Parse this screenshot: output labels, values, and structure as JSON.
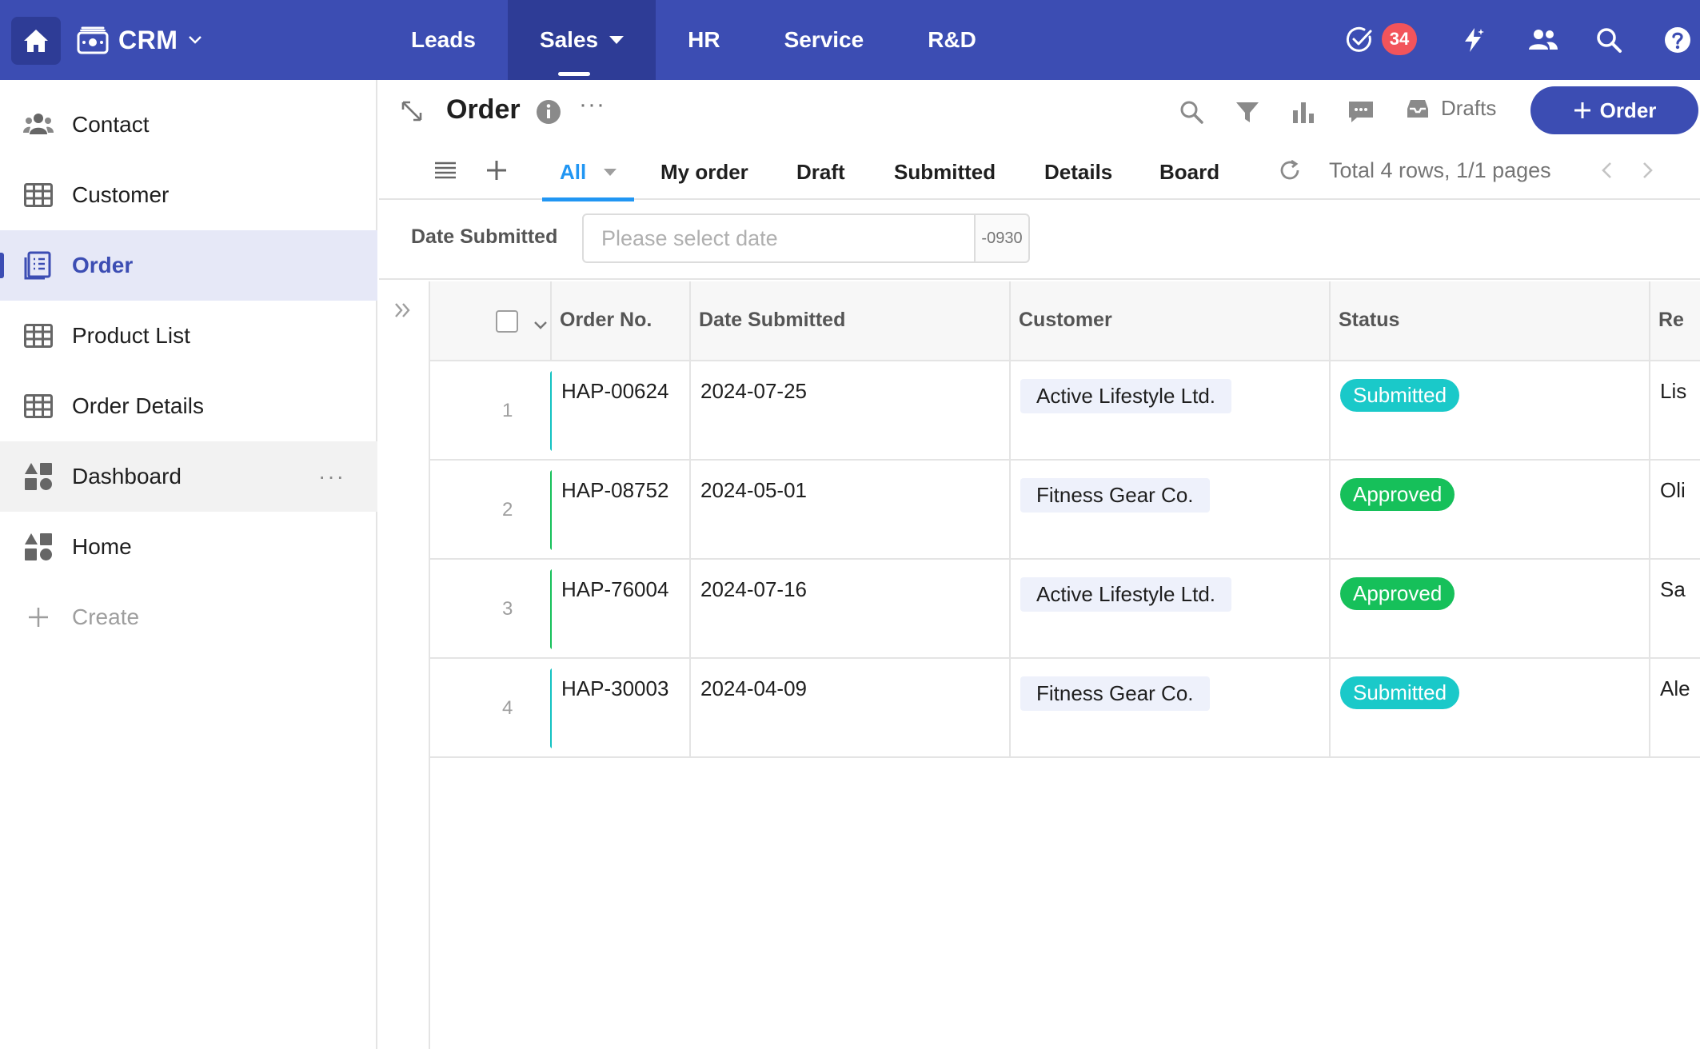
{
  "topbar": {
    "app_name": "CRM",
    "nav": [
      {
        "label": "Leads",
        "active": false
      },
      {
        "label": "Sales",
        "active": true
      },
      {
        "label": "HR",
        "active": false
      },
      {
        "label": "Service",
        "active": false
      },
      {
        "label": "R&D",
        "active": false
      }
    ],
    "notification_count": "34",
    "colors": {
      "bar": "#3c4db3",
      "bar_active": "#2e3c96",
      "badge": "#f2545b"
    },
    "icons": [
      "home-icon",
      "app-wallet-icon",
      "task-check-icon",
      "lightning-icon",
      "people-icon",
      "search-icon",
      "help-icon"
    ]
  },
  "sidebar": {
    "items": [
      {
        "label": "Contact",
        "icon": "contacts-icon",
        "active": false
      },
      {
        "label": "Customer",
        "icon": "table-icon",
        "active": false
      },
      {
        "label": "Order",
        "icon": "form-list-icon",
        "active": true
      },
      {
        "label": "Product List",
        "icon": "table-icon",
        "active": false
      },
      {
        "label": "Order Details",
        "icon": "table-icon",
        "active": false
      },
      {
        "label": "Dashboard",
        "icon": "dashboard-icon",
        "active": false
      },
      {
        "label": "Home",
        "icon": "dashboard-icon",
        "active": false
      }
    ],
    "create_label": "Create"
  },
  "header": {
    "title": "Order",
    "drafts_label": "Drafts",
    "add_button_label": "Order"
  },
  "tabs": {
    "items": [
      "All",
      "My order",
      "Draft",
      "Submitted",
      "Details",
      "Board"
    ],
    "active": "All",
    "total_text": "Total 4 rows, 1/1 pages"
  },
  "filter": {
    "label": "Date Submitted",
    "placeholder": "Please select date",
    "suffix": "-0930"
  },
  "table": {
    "columns": [
      "Order No.",
      "Date Submitted",
      "Customer",
      "Status",
      "Re"
    ],
    "rows": [
      {
        "index": "1",
        "order_no": "HAP-00624",
        "date": "2024-07-25",
        "customer": "Active Lifestyle Ltd.",
        "status": "Submitted",
        "rest": "Lis",
        "bar_color": "#13c2c2"
      },
      {
        "index": "2",
        "order_no": "HAP-08752",
        "date": "2024-05-01",
        "customer": "Fitness Gear Co.",
        "status": "Approved",
        "rest": "Oli",
        "bar_color": "#16c05a"
      },
      {
        "index": "3",
        "order_no": "HAP-76004",
        "date": "2024-07-16",
        "customer": "Active Lifestyle Ltd.",
        "status": "Approved",
        "rest": "Sa",
        "bar_color": "#16c05a"
      },
      {
        "index": "4",
        "order_no": "HAP-30003",
        "date": "2024-04-09",
        "customer": "Fitness Gear Co.",
        "status": "Submitted",
        "rest": "Ale",
        "bar_color": "#13c2c2"
      }
    ],
    "status_colors": {
      "Submitted": "#1ac9c9",
      "Approved": "#16c05a"
    }
  }
}
